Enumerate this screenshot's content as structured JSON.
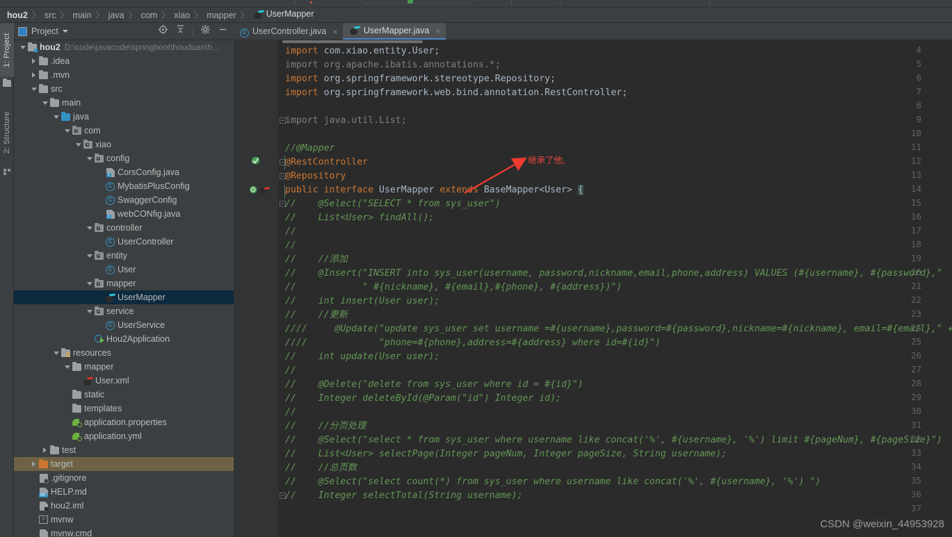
{
  "breadcrumb": {
    "items": [
      {
        "label": "hou2",
        "icon": "none",
        "bold": true
      },
      {
        "label": "src",
        "icon": "none"
      },
      {
        "label": "main",
        "icon": "none"
      },
      {
        "label": "java",
        "icon": "none"
      },
      {
        "label": "com",
        "icon": "none"
      },
      {
        "label": "xiao",
        "icon": "none"
      },
      {
        "label": "mapper",
        "icon": "none"
      },
      {
        "label": "UserMapper",
        "icon": "mybatis-icon"
      }
    ],
    "separator": "〉"
  },
  "tool_tabs": [
    {
      "label": "1: Project",
      "icon": "project-icon",
      "selected": true
    },
    {
      "label": "2: Structure",
      "icon": "structure-icon",
      "selected": false
    }
  ],
  "project_panel": {
    "title": "Project",
    "caret": "▼",
    "toolbar_icons": [
      "locate-icon",
      "collapse-all-icon",
      "gear-icon",
      "hide-icon"
    ],
    "tree": [
      {
        "depth": 0,
        "arrow": "down",
        "icon": "module-folder",
        "label": "hou2",
        "bold": true,
        "path": "D:\\code\\javacode\\springboot\\houduan\\h…"
      },
      {
        "depth": 1,
        "arrow": "right",
        "icon": "folder",
        "label": ".idea"
      },
      {
        "depth": 1,
        "arrow": "right",
        "icon": "folder",
        "label": ".mvn"
      },
      {
        "depth": 1,
        "arrow": "down",
        "icon": "folder",
        "label": "src"
      },
      {
        "depth": 2,
        "arrow": "down",
        "icon": "folder",
        "label": "main"
      },
      {
        "depth": 3,
        "arrow": "down",
        "icon": "folder-blue",
        "label": "java"
      },
      {
        "depth": 4,
        "arrow": "down",
        "icon": "package",
        "label": "com"
      },
      {
        "depth": 5,
        "arrow": "down",
        "icon": "package",
        "label": "xiao"
      },
      {
        "depth": 6,
        "arrow": "down",
        "icon": "package",
        "label": "config"
      },
      {
        "depth": 7,
        "arrow": "none",
        "icon": "java-file",
        "label": "CorsConfig.java"
      },
      {
        "depth": 7,
        "arrow": "none",
        "icon": "class",
        "label": "MybatisPlusConfig"
      },
      {
        "depth": 7,
        "arrow": "none",
        "icon": "class",
        "label": "SwaggerConfig"
      },
      {
        "depth": 7,
        "arrow": "none",
        "icon": "java-file",
        "label": "webCONfig.java"
      },
      {
        "depth": 6,
        "arrow": "down",
        "icon": "package",
        "label": "controller"
      },
      {
        "depth": 7,
        "arrow": "none",
        "icon": "class",
        "label": "UserController"
      },
      {
        "depth": 6,
        "arrow": "down",
        "icon": "package",
        "label": "entity"
      },
      {
        "depth": 7,
        "arrow": "none",
        "icon": "class",
        "label": "User"
      },
      {
        "depth": 6,
        "arrow": "down",
        "icon": "package",
        "label": "mapper"
      },
      {
        "depth": 7,
        "arrow": "none",
        "icon": "mybatis",
        "label": "UserMapper",
        "selected": "blue"
      },
      {
        "depth": 6,
        "arrow": "down",
        "icon": "package",
        "label": "service"
      },
      {
        "depth": 7,
        "arrow": "none",
        "icon": "class",
        "label": "UserService"
      },
      {
        "depth": 6,
        "arrow": "none",
        "icon": "spring-run",
        "label": "Hou2Application"
      },
      {
        "depth": 3,
        "arrow": "down",
        "icon": "folder-res",
        "label": "resources"
      },
      {
        "depth": 4,
        "arrow": "down",
        "icon": "folder",
        "label": "mapper"
      },
      {
        "depth": 5,
        "arrow": "none",
        "icon": "mybatis-red",
        "label": "User.xml"
      },
      {
        "depth": 4,
        "arrow": "none",
        "icon": "folder",
        "label": "static"
      },
      {
        "depth": 4,
        "arrow": "none",
        "icon": "folder",
        "label": "templates"
      },
      {
        "depth": 4,
        "arrow": "none",
        "icon": "spring-cfg",
        "label": "application.properties"
      },
      {
        "depth": 4,
        "arrow": "none",
        "icon": "spring-cfg",
        "label": "application.yml"
      },
      {
        "depth": 2,
        "arrow": "right",
        "icon": "folder",
        "label": "test"
      },
      {
        "depth": 1,
        "arrow": "right",
        "icon": "folder-orange",
        "label": "target",
        "selected": "olive"
      },
      {
        "depth": 1,
        "arrow": "none",
        "icon": "gitignore",
        "label": ".gitignore"
      },
      {
        "depth": 1,
        "arrow": "none",
        "icon": "md-file",
        "label": "HELP.md"
      },
      {
        "depth": 1,
        "arrow": "none",
        "icon": "iml-file",
        "label": "hou2.iml"
      },
      {
        "depth": 1,
        "arrow": "none",
        "icon": "shell-file",
        "label": "mvnw"
      },
      {
        "depth": 1,
        "arrow": "none",
        "icon": "cmd-file",
        "label": "mvnw.cmd"
      }
    ]
  },
  "editor_tabs": [
    {
      "label": "UserController.java",
      "icon": "class-icon",
      "active": false,
      "close": "×"
    },
    {
      "label": "UserMapper.java",
      "icon": "mybatis-icon",
      "active": true,
      "close": "×"
    }
  ],
  "editor": {
    "first_visible_line": 4,
    "lines": [
      {
        "n": 4,
        "tokens": [
          {
            "t": "import ",
            "c": "kw"
          },
          {
            "t": "com.xiao.entity.",
            "c": "plain"
          },
          {
            "t": "User",
            "c": "plain"
          },
          {
            "t": ";",
            "c": "plain"
          }
        ]
      },
      {
        "n": 5,
        "tokens": [
          {
            "t": "import org.apache.ibatis.annotations.*;",
            "c": "dim"
          }
        ]
      },
      {
        "n": 6,
        "tokens": [
          {
            "t": "import ",
            "c": "kw"
          },
          {
            "t": "org.springframework.stereotype.",
            "c": "plain"
          },
          {
            "t": "Repository",
            "c": "plain"
          },
          {
            "t": ";",
            "c": "plain"
          }
        ]
      },
      {
        "n": 7,
        "tokens": [
          {
            "t": "import ",
            "c": "kw"
          },
          {
            "t": "org.springframework.web.bind.annotation.",
            "c": "plain"
          },
          {
            "t": "RestController",
            "c": "plain"
          },
          {
            "t": ";",
            "c": "plain"
          }
        ]
      },
      {
        "n": 8,
        "tokens": []
      },
      {
        "n": 9,
        "tokens": [
          {
            "t": "import java.util.List;",
            "c": "dim"
          }
        ],
        "fold": "minus"
      },
      {
        "n": 10,
        "tokens": []
      },
      {
        "n": 11,
        "tokens": [
          {
            "t": "//@Mapper",
            "c": "cmt"
          }
        ]
      },
      {
        "n": 12,
        "tokens": [
          {
            "t": "@RestController",
            "c": "kw"
          }
        ],
        "gutter": "spring-bean",
        "fold": "minus"
      },
      {
        "n": 13,
        "tokens": [
          {
            "t": "@Repository",
            "c": "kw"
          }
        ],
        "fold": "minus"
      },
      {
        "n": 14,
        "tokens": [
          {
            "t": "public ",
            "c": "kw"
          },
          {
            "t": "interface ",
            "c": "kw"
          },
          {
            "t": "UserMapper ",
            "c": "plain"
          },
          {
            "t": "extends ",
            "c": "kw"
          },
          {
            "t": "BaseMapper<User> ",
            "c": "plain"
          },
          {
            "t": "{",
            "c": "brace"
          }
        ],
        "gutter": "spring-mybatis"
      },
      {
        "n": 15,
        "tokens": [
          {
            "t": "//    @Select(\"SELECT * from sys_user\")",
            "c": "cmt"
          }
        ],
        "fold": "minus"
      },
      {
        "n": 16,
        "tokens": [
          {
            "t": "//    List<User> findAll();",
            "c": "cmt"
          }
        ]
      },
      {
        "n": 17,
        "tokens": [
          {
            "t": "//",
            "c": "cmt"
          }
        ]
      },
      {
        "n": 18,
        "tokens": [
          {
            "t": "//",
            "c": "cmt"
          }
        ]
      },
      {
        "n": 19,
        "tokens": [
          {
            "t": "//    //添加",
            "c": "cmt"
          }
        ]
      },
      {
        "n": 20,
        "tokens": [
          {
            "t": "//    @Insert(\"INSERT into sys_user(username, password,nickname,email,phone,address) VALUES (#{username}, #{password},\"",
            "c": "cmt"
          }
        ]
      },
      {
        "n": 21,
        "tokens": [
          {
            "t": "//            \" #{nickname}, #{email},#{phone}, #{address})\")",
            "c": "cmt"
          }
        ]
      },
      {
        "n": 22,
        "tokens": [
          {
            "t": "//    int insert(User user);",
            "c": "cmt"
          }
        ]
      },
      {
        "n": 23,
        "tokens": [
          {
            "t": "//    //更新",
            "c": "cmt"
          }
        ]
      },
      {
        "n": 24,
        "tokens": [
          {
            "t": "////     @Update(\"update sys_user set username =#{username},password=#{password},nickname=#{nickname}, email=#{email},\" +",
            "c": "cmt"
          }
        ]
      },
      {
        "n": 25,
        "tokens": [
          {
            "t": "////             \"phone=#{phone},address=#{address} where id=#{id}\")",
            "c": "cmt"
          }
        ]
      },
      {
        "n": 26,
        "tokens": [
          {
            "t": "//    int update(User user);",
            "c": "cmt"
          }
        ]
      },
      {
        "n": 27,
        "tokens": [
          {
            "t": "//",
            "c": "cmt"
          }
        ]
      },
      {
        "n": 28,
        "tokens": [
          {
            "t": "//    @Delete(\"delete from sys_user where id = #{id}\")",
            "c": "cmt"
          }
        ]
      },
      {
        "n": 29,
        "tokens": [
          {
            "t": "//    Integer deleteById(@Param(\"id\") Integer id);",
            "c": "cmt"
          }
        ]
      },
      {
        "n": 30,
        "tokens": [
          {
            "t": "//",
            "c": "cmt"
          }
        ]
      },
      {
        "n": 31,
        "tokens": [
          {
            "t": "//    //分页处理",
            "c": "cmt"
          }
        ]
      },
      {
        "n": 32,
        "tokens": [
          {
            "t": "//    @Select(\"select * from sys_user where username like concat('%', #{username}, '%') limit #{pageNum}, #{pageSize}\")",
            "c": "cmt"
          }
        ]
      },
      {
        "n": 33,
        "tokens": [
          {
            "t": "//    List<User> selectPage(Integer pageNum, Integer pageSize, String username);",
            "c": "cmt"
          }
        ]
      },
      {
        "n": 34,
        "tokens": [
          {
            "t": "//    //总页数",
            "c": "cmt"
          }
        ]
      },
      {
        "n": 35,
        "tokens": [
          {
            "t": "//    @Select(\"select count(*) from sys_user where username like concat('%', #{username}, '%') \")",
            "c": "cmt"
          }
        ]
      },
      {
        "n": 36,
        "tokens": [
          {
            "t": "//    Integer selectTotal(String username);",
            "c": "cmt"
          }
        ],
        "fold": "minus"
      },
      {
        "n": 37,
        "tokens": []
      }
    ]
  },
  "annotation": {
    "text": "继承了他,",
    "color": "#e8453c"
  },
  "watermark": {
    "text": "CSDN @weixin_44953928"
  },
  "colors": {
    "editor_background": "#2b2b2b",
    "panel_background": "#3c3f41",
    "gutter_background": "#313335",
    "selection_blue": "#0d293e",
    "selection_olive": "#6e6244",
    "keyword": "#cc7832",
    "comment": "#629755",
    "string": "#6a8759",
    "plain_text": "#a9b7c6",
    "line_number": "#606366",
    "accent": "#4a88c7",
    "annotation_red": "#e8453c"
  }
}
